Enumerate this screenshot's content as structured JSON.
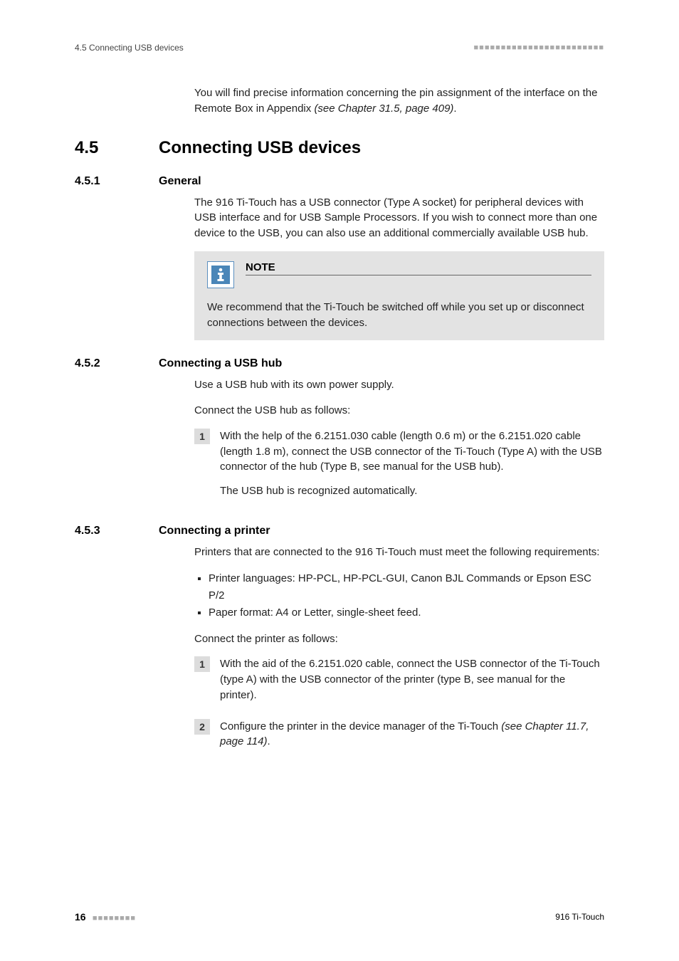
{
  "header": {
    "left": "4.5 Connecting USB devices",
    "decor": "■■■■■■■■■■■■■■■■■■■■■■■■"
  },
  "intro_line1": "You will find precise information concerning the pin assignment of the interface on the Remote Box in Appendix ",
  "intro_ref": "(see Chapter 31.5, page 409)",
  "intro_dot": ".",
  "sec45": {
    "num": "4.5",
    "title": "Connecting USB devices"
  },
  "sec451": {
    "num": "4.5.1",
    "title": "General",
    "p1": "The 916 Ti-Touch has a USB connector (Type A socket) for peripheral devices with USB interface and for USB Sample Processors. If you wish to connect more than one device to the USB, you can also use an additional commercially available USB hub.",
    "note_label": "NOTE",
    "note_body": "We recommend that the Ti-Touch be switched off while you set up or disconnect connections between the devices."
  },
  "sec452": {
    "num": "4.5.2",
    "title": "Connecting a USB hub",
    "p1": "Use a USB hub with its own power supply.",
    "p2": "Connect the USB hub as follows:",
    "step1_num": "1",
    "step1_a": "With the help of the 6.2151.030 cable (length 0.6 m) or the 6.2151.020 cable (length 1.8 m), connect the USB connector of the Ti-Touch (Type A) with the USB connector of the hub (Type B, see manual for the USB hub).",
    "step1_b": "The USB hub is recognized automatically."
  },
  "sec453": {
    "num": "4.5.3",
    "title": "Connecting a printer",
    "p1": "Printers that are connected to the 916 Ti-Touch must meet the following requirements:",
    "req1": "Printer languages: HP-PCL, HP-PCL-GUI, Canon BJL Commands or Epson ESC P/2",
    "req2": "Paper format: A4 or Letter, single-sheet feed.",
    "p2": "Connect the printer as follows:",
    "step1_num": "1",
    "step1": "With the aid of the 6.2151.020 cable, connect the USB connector of the Ti-Touch (type A) with the USB connector of the printer (type B, see manual for the printer).",
    "step2_num": "2",
    "step2_a": "Configure the printer in the device manager of the Ti-Touch ",
    "step2_ref": "(see Chapter 11.7, page 114)",
    "step2_dot": "."
  },
  "footer": {
    "page": "16",
    "decor": "■■■■■■■■",
    "right": "916 Ti-Touch"
  }
}
